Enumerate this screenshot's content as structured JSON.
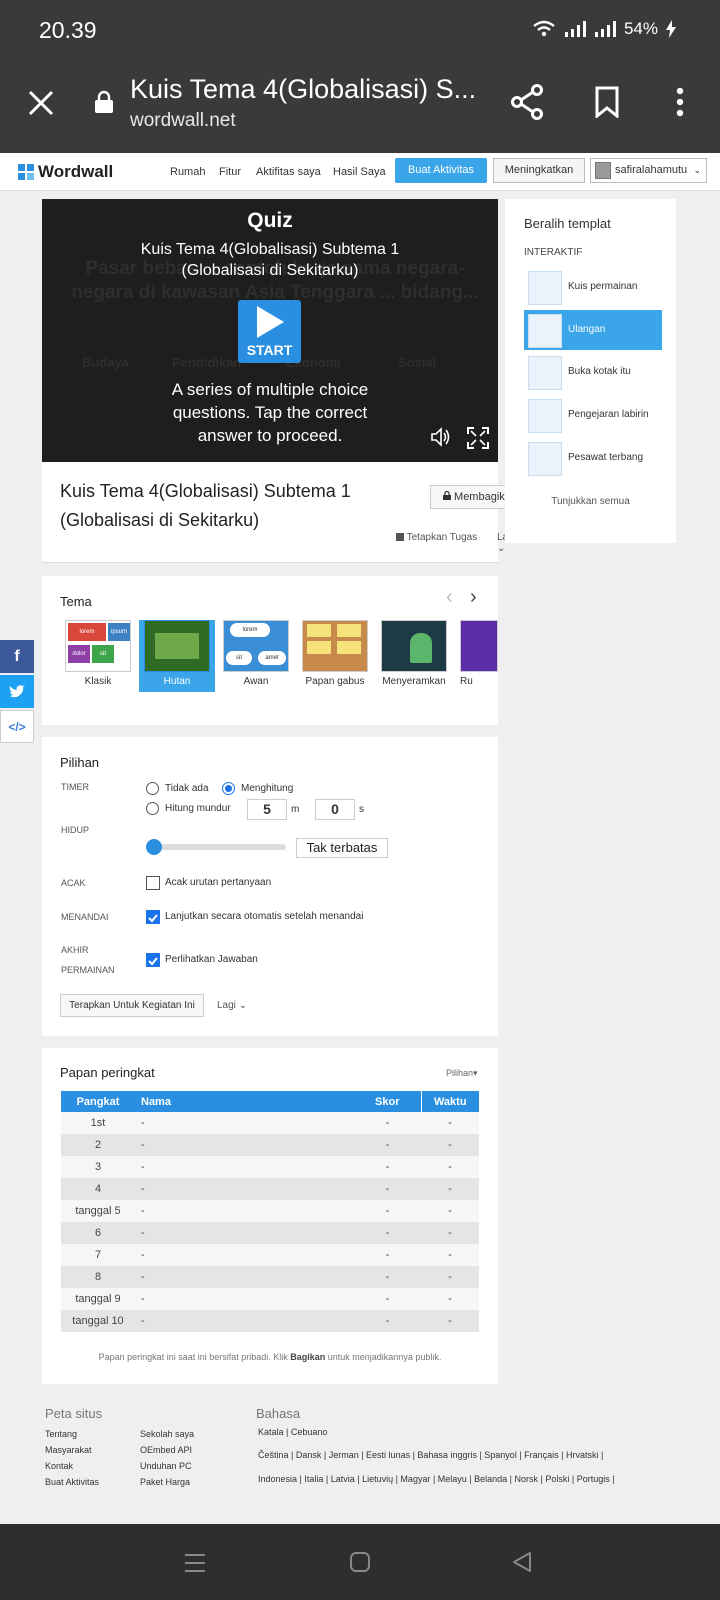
{
  "status": {
    "time": "20.39",
    "battery": "54%"
  },
  "browser": {
    "title": "Kuis Tema 4(Globalisasi) S...",
    "url": "wordwall.net"
  },
  "nav": {
    "logo": "Wordwall",
    "links": [
      "Rumah",
      "Fitur",
      "Aktifitas saya",
      "Hasil Saya"
    ],
    "create": "Buat Aktivitas",
    "upgrade": "Meningkatkan",
    "user": "safiralahamutu"
  },
  "hero": {
    "label": "Quiz",
    "subtitle": "Kuis Tema 4(Globalisasi) Subtema 1 (Globalisasi di Sekitarku)",
    "bg_question": "Pasar bebas ... contoh kerja sama negara-negara di kawasan Asia Tenggara ... bidang...",
    "categories": [
      "Budaya",
      "Pendidikan",
      "Ekonomi",
      "Sosial"
    ],
    "start": "START",
    "description": "A series of multiple choice questions. Tap the correct answer to proceed."
  },
  "activity": {
    "title": "Kuis Tema 4(Globalisasi) Subtema 1 (Globalisasi di Sekitarku)",
    "share": "Membagikan",
    "assign": "Tetapkan Tugas",
    "more": "Lagi"
  },
  "sidebar": {
    "heading": "Beralih templat",
    "section": "INTERAKTIF",
    "items": [
      "Kuis permainan",
      "Ulangan",
      "Buka kotak itu",
      "Pengejaran labirin",
      "Pesawat terbang"
    ],
    "show_all": "Tunjukkan semua"
  },
  "themes": {
    "heading": "Tema",
    "items": [
      "Klasik",
      "Hutan",
      "Awan",
      "Papan gabus",
      "Menyeramkan",
      "Ru"
    ],
    "thumb_words": [
      "lorem",
      "ipsum",
      "dolor",
      "sit",
      "amet"
    ]
  },
  "options": {
    "heading": "Pilihan",
    "timer_label": "TIMER",
    "timer_none": "Tidak ada",
    "timer_count": "Menghitung",
    "timer_down": "Hitung mundur",
    "minutes": "5",
    "m": "m",
    "seconds": "0",
    "s": "s",
    "lives_label": "HIDUP",
    "lives_value": "Tak terbatas",
    "shuffle_label": "ACAK",
    "shuffle_text": "Acak urutan pertanyaan",
    "mark_label": "MENANDAI",
    "mark_text": "Lanjutkan secara otomatis setelah menandai",
    "end_label_1": "AKHIR",
    "end_label_2": "PERMAINAN",
    "end_text": "Perlihatkan Jawaban",
    "apply": "Terapkan Untuk Kegiatan Ini",
    "more": "Lagi"
  },
  "leaderboard": {
    "heading": "Papan peringkat",
    "options": "Pilihan",
    "columns": [
      "Pangkat",
      "Nama",
      "Skor",
      "Waktu"
    ],
    "rows": [
      [
        "1st",
        "-",
        "-",
        "-"
      ],
      [
        "2",
        "-",
        "-",
        "-"
      ],
      [
        "3",
        "-",
        "-",
        "-"
      ],
      [
        "4",
        "-",
        "-",
        "-"
      ],
      [
        "tanggal 5",
        "-",
        "-",
        "-"
      ],
      [
        "6",
        "-",
        "-",
        "-"
      ],
      [
        "7",
        "-",
        "-",
        "-"
      ],
      [
        "8",
        "-",
        "-",
        "-"
      ],
      [
        "tanggal 9",
        "-",
        "-",
        "-"
      ],
      [
        "tanggal 10",
        "-",
        "-",
        "-"
      ]
    ],
    "note_pre": "Papan peringkat ini saat ini bersifat pribadi. Klik ",
    "note_bold": "Bagikan",
    "note_post": " untuk menjadikannya publik."
  },
  "footer": {
    "sitemap": "Peta situs",
    "col1": [
      "Tentang",
      "Masyarakat",
      "Kontak",
      "Buat Aktivitas"
    ],
    "col2": [
      "Sekolah saya",
      "OEmbed API",
      "Unduhan PC",
      "Paket Harga"
    ],
    "language": "Bahasa",
    "lang_line1": "Katala | Cebuano",
    "lang_line2": "Čeština | Dansk | Jerman | Eesti lunas | Bahasa inggris | Spanyol | Français | Hrvatski |",
    "lang_line3": "Indonesia | Italia | Latvia | Lietuvių | Magyar | Melayu | Belanda | Norsk | Polski | Portugis |"
  }
}
